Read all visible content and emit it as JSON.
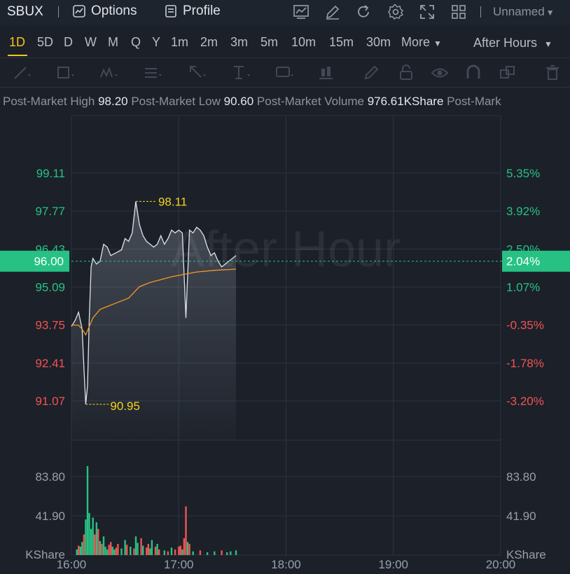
{
  "app": {
    "symbol": "SBUX",
    "tabs": [
      {
        "label": "Options",
        "icon": "options-chart-icon"
      },
      {
        "label": "Profile",
        "icon": "profile-doc-icon"
      }
    ],
    "toolbar_icons": [
      "indicator-icon",
      "draw-pen-icon",
      "refresh-icon",
      "settings-gear-icon",
      "fullscreen-icon",
      "layout-grid-icon"
    ],
    "layout_name": "Unnamed"
  },
  "intervals": {
    "items": [
      "1D",
      "5D",
      "D",
      "W",
      "M",
      "Q",
      "Y",
      "1m",
      "2m",
      "3m",
      "5m",
      "10m",
      "15m",
      "30m",
      "More"
    ],
    "active": "1D",
    "session": "After Hours"
  },
  "draw_tools": [
    "trend-line-icon",
    "rectangle-icon",
    "pattern-icon",
    "fib-icon",
    "arrow-icon",
    "text-icon",
    "annotation-icon",
    "candle-icon",
    "pencil-icon",
    "lock-icon",
    "eye-icon",
    "magnet-icon",
    "clone-icon",
    "trash-icon"
  ],
  "info": {
    "high_label": "Post-Market High",
    "high_value": "98.20",
    "low_label": "Post-Market Low",
    "low_value": "90.60",
    "volume_label": "Post-Market Volume",
    "volume_value": "976.61KShare",
    "trailing_label": "Post-Mark"
  },
  "chart_data": {
    "type": "line",
    "watermark": "After Hour",
    "price_ticks": [
      "99.11",
      "97.77",
      "96.43",
      "95.09",
      "93.75",
      "92.41",
      "91.07"
    ],
    "pct_ticks": [
      "5.35%",
      "3.92%",
      "2.50%",
      "1.07%",
      "-0.35%",
      "-1.78%",
      "-3.20%"
    ],
    "current_price": "96.00",
    "current_pct": "2.04%",
    "high_marker": "98.11",
    "low_marker": "90.95",
    "time_ticks": [
      "16:00",
      "17:00",
      "18:00",
      "19:00",
      "20:00"
    ],
    "volume_ticks": [
      "83.80",
      "41.90"
    ],
    "volume_unit": "KShare",
    "colors": {
      "up": "#27c283",
      "down": "#f25353",
      "price_line": "#dfe3ea",
      "vwap": "#f29a22",
      "marker": "#f5d21c"
    },
    "price": {
      "x": [
        0,
        2,
        4,
        6,
        7,
        8,
        9,
        10,
        11,
        12,
        14,
        16,
        18,
        20,
        22,
        25,
        28,
        30,
        32,
        34,
        36,
        38,
        40,
        42,
        44,
        46,
        48,
        50,
        52,
        54,
        56,
        58,
        60,
        62,
        64,
        66,
        68,
        70,
        72,
        74,
        76,
        78,
        80,
        82,
        84,
        86,
        88,
        90,
        92
      ],
      "y": [
        93.7,
        93.9,
        94.2,
        93.6,
        92.2,
        90.95,
        91.6,
        94.0,
        95.8,
        96.1,
        95.9,
        96.0,
        96.6,
        96.5,
        96.2,
        96.3,
        96.4,
        96.8,
        96.7,
        97.0,
        98.11,
        97.3,
        96.9,
        96.7,
        96.6,
        96.5,
        96.6,
        96.9,
        96.6,
        96.8,
        97.1,
        97.0,
        97.1,
        97.0,
        94.0,
        97.1,
        97.0,
        97.2,
        97.1,
        96.9,
        96.5,
        96.2,
        96.3,
        96.0,
        95.8,
        95.9,
        96.0,
        96.1,
        96.2
      ]
    },
    "vwap": {
      "x": [
        0,
        4,
        6,
        8,
        12,
        16,
        20,
        26,
        32,
        38,
        44,
        50,
        56,
        60,
        64,
        70,
        80,
        92
      ],
      "y": [
        93.75,
        93.74,
        93.6,
        93.4,
        94.0,
        94.3,
        94.4,
        94.55,
        94.7,
        95.1,
        95.25,
        95.35,
        95.45,
        95.5,
        95.55,
        95.62,
        95.68,
        95.72
      ]
    },
    "volume": [
      [
        3,
        6,
        "up"
      ],
      [
        4,
        10,
        "down"
      ],
      [
        5,
        9,
        "up"
      ],
      [
        6,
        14,
        "up"
      ],
      [
        7,
        22,
        "down"
      ],
      [
        8,
        38,
        "up"
      ],
      [
        9,
        95,
        "up"
      ],
      [
        10,
        45,
        "up"
      ],
      [
        11,
        28,
        "up"
      ],
      [
        12,
        40,
        "up"
      ],
      [
        13,
        22,
        "down"
      ],
      [
        14,
        35,
        "up"
      ],
      [
        15,
        28,
        "down"
      ],
      [
        16,
        15,
        "up"
      ],
      [
        17,
        12,
        "down"
      ],
      [
        18,
        20,
        "up"
      ],
      [
        19,
        9,
        "up"
      ],
      [
        20,
        6,
        "up"
      ],
      [
        21,
        11,
        "down"
      ],
      [
        22,
        14,
        "down"
      ],
      [
        23,
        9,
        "up"
      ],
      [
        24,
        6,
        "up"
      ],
      [
        25,
        8,
        "down"
      ],
      [
        26,
        12,
        "down"
      ],
      [
        28,
        7,
        "up"
      ],
      [
        30,
        16,
        "up"
      ],
      [
        31,
        11,
        "down"
      ],
      [
        33,
        9,
        "up"
      ],
      [
        35,
        7,
        "down"
      ],
      [
        36,
        20,
        "up"
      ],
      [
        37,
        13,
        "up"
      ],
      [
        39,
        18,
        "down"
      ],
      [
        40,
        10,
        "up"
      ],
      [
        42,
        8,
        "down"
      ],
      [
        43,
        12,
        "down"
      ],
      [
        44,
        7,
        "up"
      ],
      [
        45,
        16,
        "up"
      ],
      [
        47,
        9,
        "down"
      ],
      [
        48,
        12,
        "up"
      ],
      [
        49,
        6,
        "down"
      ],
      [
        52,
        5,
        "up"
      ],
      [
        54,
        4,
        "down"
      ],
      [
        56,
        8,
        "up"
      ],
      [
        58,
        6,
        "down"
      ],
      [
        60,
        9,
        "down"
      ],
      [
        61,
        10,
        "down"
      ],
      [
        62,
        6,
        "up"
      ],
      [
        63,
        18,
        "down"
      ],
      [
        64,
        52,
        "down"
      ],
      [
        65,
        14,
        "up"
      ],
      [
        66,
        12,
        "down"
      ],
      [
        68,
        4,
        "up"
      ],
      [
        72,
        5,
        "down"
      ],
      [
        76,
        3,
        "up"
      ],
      [
        80,
        4,
        "up"
      ],
      [
        84,
        5,
        "down"
      ],
      [
        87,
        3,
        "up"
      ],
      [
        89,
        4,
        "up"
      ],
      [
        92,
        5,
        "up"
      ]
    ]
  }
}
